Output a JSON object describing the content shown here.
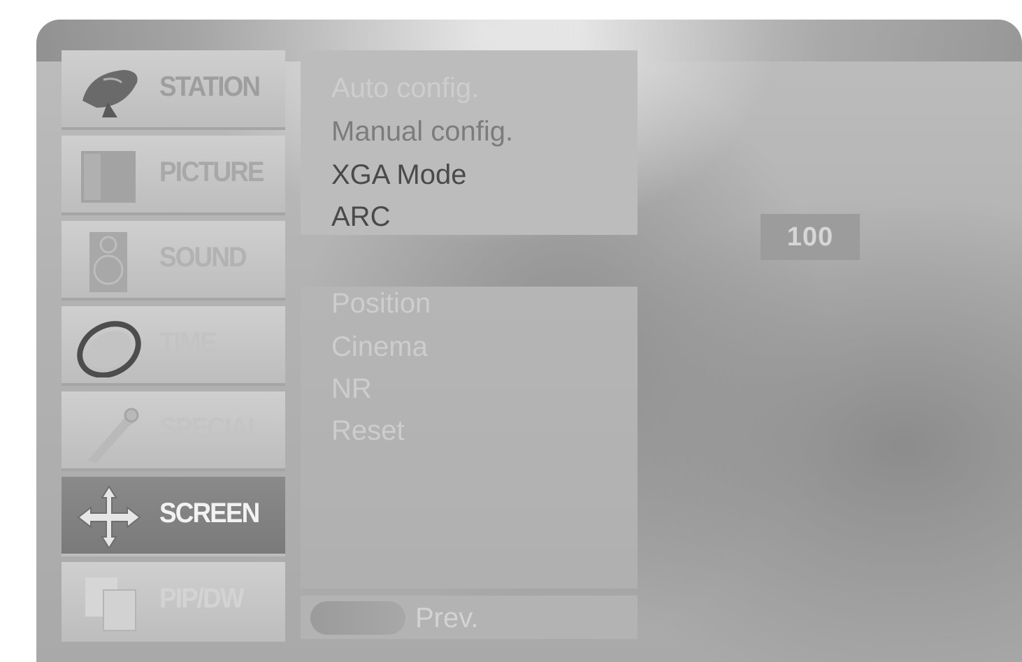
{
  "sidebar": {
    "tabs": [
      {
        "label": "STATION",
        "icon": "satellite-dish-icon",
        "active": false
      },
      {
        "label": "PICTURE",
        "icon": "picture-frame-icon",
        "active": false
      },
      {
        "label": "SOUND",
        "icon": "speaker-icon",
        "active": false
      },
      {
        "label": "TIME",
        "icon": "clock-icon",
        "active": false
      },
      {
        "label": "SPECIAL",
        "icon": "wrench-icon",
        "active": false
      },
      {
        "label": "SCREEN",
        "icon": "move-arrows-icon",
        "active": true
      },
      {
        "label": "PIP/DW",
        "icon": "pip-windows-icon",
        "active": false
      }
    ]
  },
  "menu": {
    "top_items": [
      "Auto config.",
      "Manual config.",
      "XGA Mode",
      "ARC"
    ],
    "bottom_items": [
      "Position",
      "Cinema",
      "NR",
      "Reset"
    ],
    "prev_label": "Prev."
  },
  "value_display": "100",
  "colors": {
    "panel": "#b3b3b3",
    "active_tab": "#7a7a7a",
    "value_box": "#9c9c9c"
  }
}
